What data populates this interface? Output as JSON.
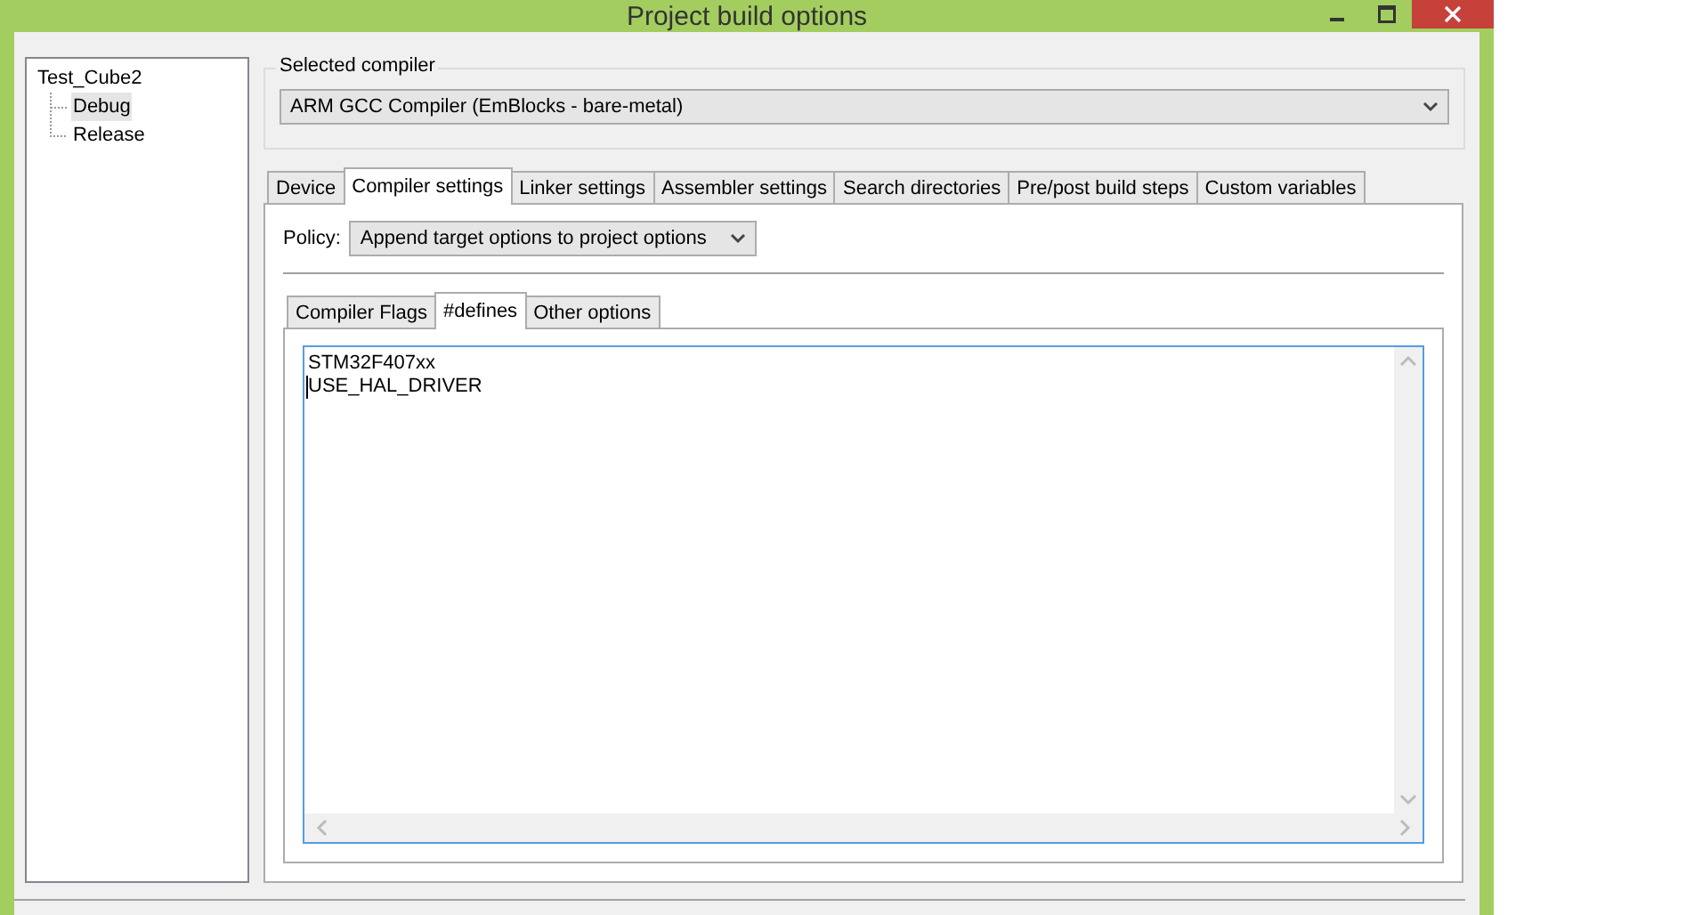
{
  "window": {
    "title": "Project build options"
  },
  "tree": [
    {
      "label": "Test_Cube2",
      "selected": false,
      "children": [
        {
          "label": "Debug",
          "selected": true
        },
        {
          "label": "Release",
          "selected": false
        }
      ]
    }
  ],
  "compiler_group": {
    "label": "Selected compiler",
    "value": "ARM GCC Compiler (EmBlocks - bare-metal)"
  },
  "tabs": [
    {
      "label": "Device",
      "selected": false
    },
    {
      "label": "Compiler settings",
      "selected": true
    },
    {
      "label": "Linker settings",
      "selected": false
    },
    {
      "label": "Assembler settings",
      "selected": false
    },
    {
      "label": "Search directories",
      "selected": false
    },
    {
      "label": "Pre/post build steps",
      "selected": false
    },
    {
      "label": "Custom variables",
      "selected": false
    }
  ],
  "policy": {
    "label": "Policy:",
    "value": "Append target options to project options"
  },
  "subtabs": [
    {
      "label": "Compiler Flags",
      "selected": false
    },
    {
      "label": "#defines",
      "selected": true
    },
    {
      "label": "Other options",
      "selected": false
    }
  ],
  "editor": {
    "lines": [
      {
        "text": "STM32F407xx",
        "caret": false
      },
      {
        "text": "USE_HAL_DRIVER",
        "caret": true
      }
    ]
  }
}
